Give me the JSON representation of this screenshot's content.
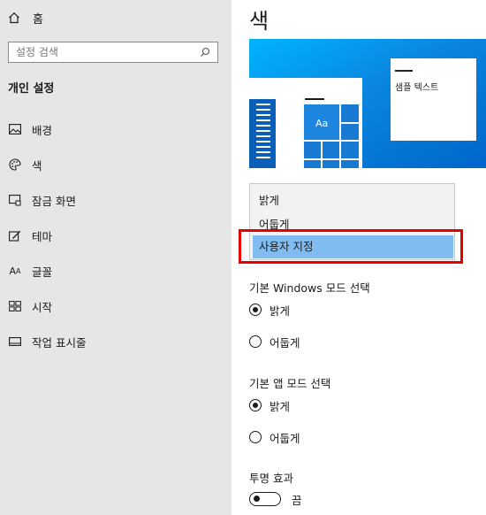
{
  "sidebar": {
    "home_label": "홈",
    "search_placeholder": "설정 검색",
    "section_title": "개인 설정",
    "items": [
      {
        "label": "배경",
        "icon": "picture-icon"
      },
      {
        "label": "색",
        "icon": "palette-icon"
      },
      {
        "label": "잠금 화면",
        "icon": "lock-screen-icon"
      },
      {
        "label": "테마",
        "icon": "theme-icon"
      },
      {
        "label": "글꼴",
        "icon": "font-icon"
      },
      {
        "label": "시작",
        "icon": "start-icon"
      },
      {
        "label": "작업 표시줄",
        "icon": "taskbar-icon"
      }
    ]
  },
  "main": {
    "title": "색",
    "preview": {
      "sample_text": "샘플 텍스트",
      "tile_text": "Aa"
    },
    "dropdown": {
      "options": [
        "밝게",
        "어둡게",
        "사용자 지정"
      ],
      "selected": "사용자 지정"
    },
    "windows_mode": {
      "label": "기본 Windows 모드 선택",
      "options": [
        {
          "label": "밝게",
          "checked": true
        },
        {
          "label": "어둡게",
          "checked": false
        }
      ]
    },
    "app_mode": {
      "label": "기본 앱 모드 선택",
      "options": [
        {
          "label": "밝게",
          "checked": true
        },
        {
          "label": "어둡게",
          "checked": false
        }
      ]
    },
    "transparency": {
      "label": "투명 효과",
      "state": "끔",
      "on": false
    }
  },
  "colors": {
    "sidebar_bg": "#e6e6e6",
    "accent_blue": "#0a86e0",
    "selection": "#80bcef",
    "highlight_border": "#e60000"
  }
}
